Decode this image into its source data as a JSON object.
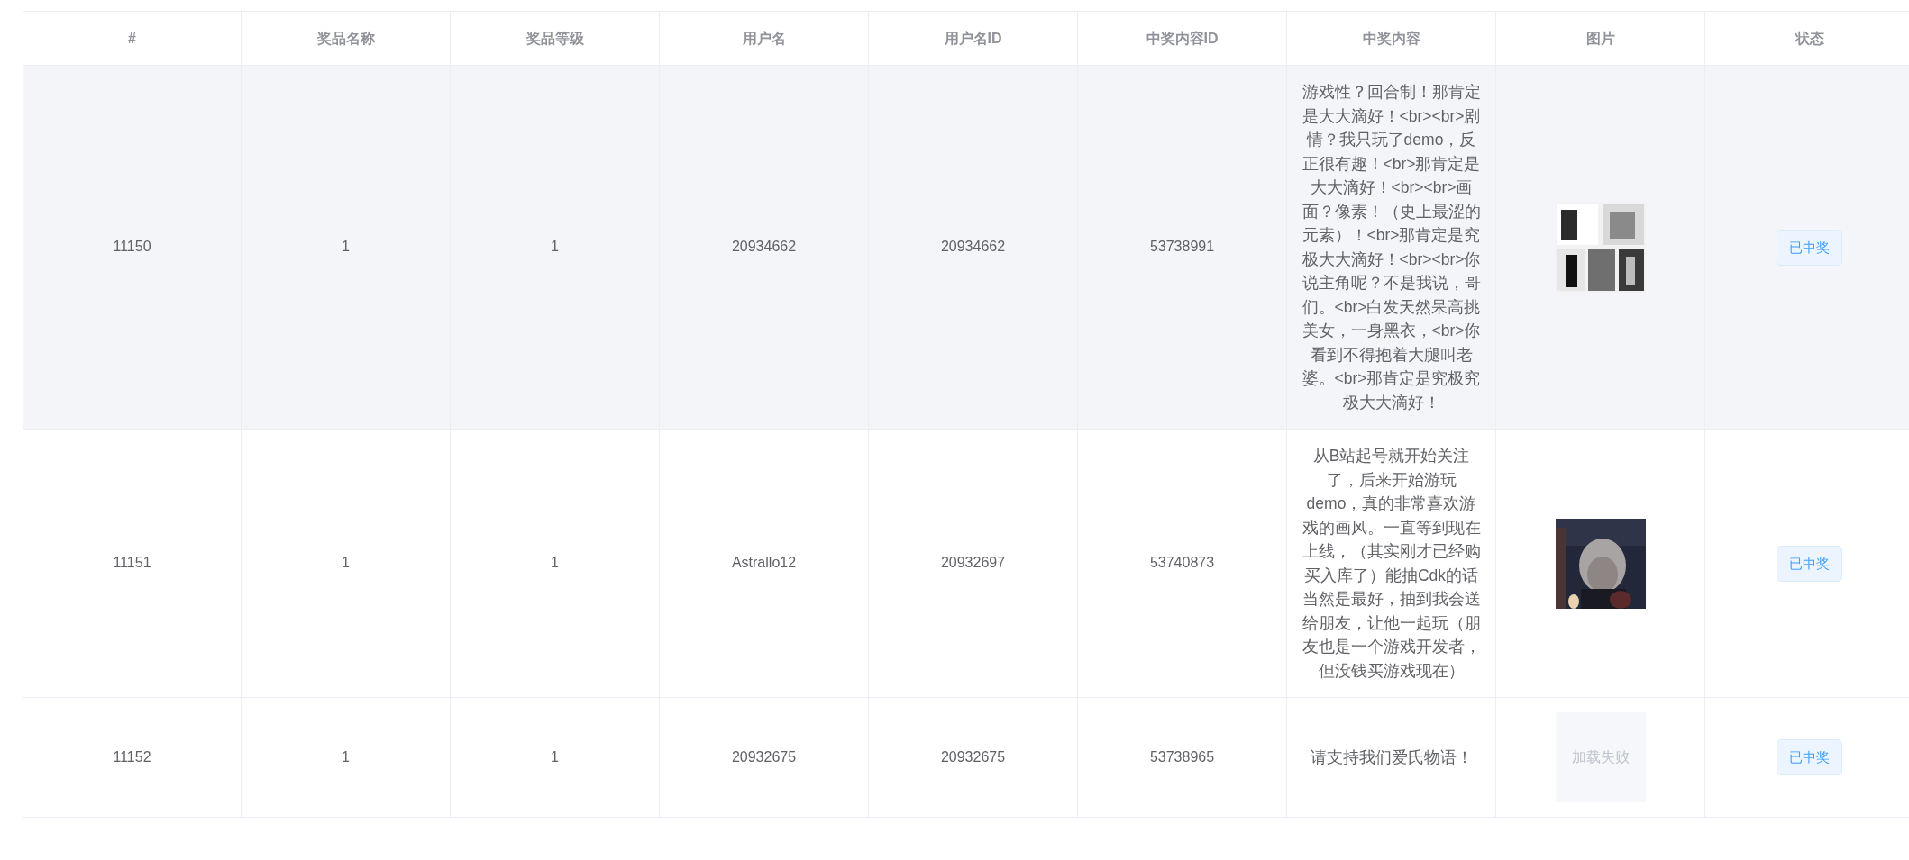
{
  "table": {
    "columns": [
      "#",
      "奖品名称",
      "奖品等级",
      "用户名",
      "用户名ID",
      "中奖内容ID",
      "中奖内容",
      "图片",
      "状态"
    ],
    "rows": [
      {
        "hovered": true,
        "id": "11150",
        "prize_name": "1",
        "prize_level": "1",
        "username": "20934662",
        "user_id": "20934662",
        "content_id": "53738991",
        "content": "游戏性？回合制！那肯定是大大滴好！<br><br>剧情？我只玩了demo，反正很有趣！<br>那肯定是大大滴好！<br><br>画面？像素！（史上最涩的元素）！<br>那肯定是究极大大滴好！<br><br>你说主角呢？不是我说，哥们。<br>白发天然呆高挑美女，一身黑衣，<br>你看到不得抱着大腿叫老婆。<br>那肯定是究极究极大大滴好！",
        "status": "已中奖"
      },
      {
        "hovered": false,
        "id": "11151",
        "prize_name": "1",
        "prize_level": "1",
        "username": "Astrallo12",
        "user_id": "20932697",
        "content_id": "53740873",
        "content": "从B站起号就开始关注了，后来开始游玩demo，真的非常喜欢游戏的画风。一直等到现在上线，（其实刚才已经购买入库了）能抽Cdk的话当然是最好，抽到我会送给朋友，让他一起玩（朋友也是一个游戏开发者，但没钱买游戏现在）",
        "status": "已中奖"
      },
      {
        "hovered": false,
        "id": "11152",
        "prize_name": "1",
        "prize_level": "1",
        "username": "20932675",
        "user_id": "20932675",
        "content_id": "53738965",
        "content": "请支持我们爱氏物语！",
        "image": {
          "kind": "failed",
          "text": "加载失败"
        },
        "status": "已中奖"
      }
    ]
  }
}
